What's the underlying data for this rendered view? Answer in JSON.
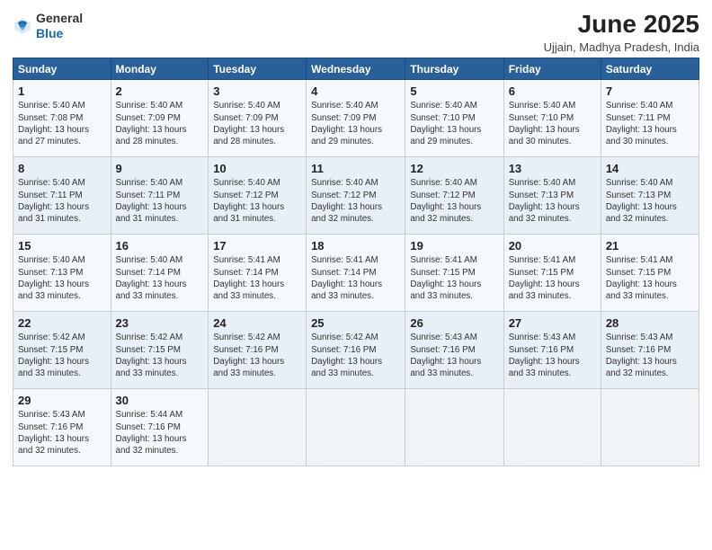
{
  "app": {
    "logo_line1": "General",
    "logo_line2": "Blue"
  },
  "header": {
    "title": "June 2025",
    "subtitle": "Ujjain, Madhya Pradesh, India"
  },
  "weekdays": [
    "Sunday",
    "Monday",
    "Tuesday",
    "Wednesday",
    "Thursday",
    "Friday",
    "Saturday"
  ],
  "weeks": [
    [
      {
        "day": "1",
        "info": "Sunrise: 5:40 AM\nSunset: 7:08 PM\nDaylight: 13 hours\nand 27 minutes."
      },
      {
        "day": "2",
        "info": "Sunrise: 5:40 AM\nSunset: 7:09 PM\nDaylight: 13 hours\nand 28 minutes."
      },
      {
        "day": "3",
        "info": "Sunrise: 5:40 AM\nSunset: 7:09 PM\nDaylight: 13 hours\nand 28 minutes."
      },
      {
        "day": "4",
        "info": "Sunrise: 5:40 AM\nSunset: 7:09 PM\nDaylight: 13 hours\nand 29 minutes."
      },
      {
        "day": "5",
        "info": "Sunrise: 5:40 AM\nSunset: 7:10 PM\nDaylight: 13 hours\nand 29 minutes."
      },
      {
        "day": "6",
        "info": "Sunrise: 5:40 AM\nSunset: 7:10 PM\nDaylight: 13 hours\nand 30 minutes."
      },
      {
        "day": "7",
        "info": "Sunrise: 5:40 AM\nSunset: 7:11 PM\nDaylight: 13 hours\nand 30 minutes."
      }
    ],
    [
      {
        "day": "8",
        "info": "Sunrise: 5:40 AM\nSunset: 7:11 PM\nDaylight: 13 hours\nand 31 minutes."
      },
      {
        "day": "9",
        "info": "Sunrise: 5:40 AM\nSunset: 7:11 PM\nDaylight: 13 hours\nand 31 minutes."
      },
      {
        "day": "10",
        "info": "Sunrise: 5:40 AM\nSunset: 7:12 PM\nDaylight: 13 hours\nand 31 minutes."
      },
      {
        "day": "11",
        "info": "Sunrise: 5:40 AM\nSunset: 7:12 PM\nDaylight: 13 hours\nand 32 minutes."
      },
      {
        "day": "12",
        "info": "Sunrise: 5:40 AM\nSunset: 7:12 PM\nDaylight: 13 hours\nand 32 minutes."
      },
      {
        "day": "13",
        "info": "Sunrise: 5:40 AM\nSunset: 7:13 PM\nDaylight: 13 hours\nand 32 minutes."
      },
      {
        "day": "14",
        "info": "Sunrise: 5:40 AM\nSunset: 7:13 PM\nDaylight: 13 hours\nand 32 minutes."
      }
    ],
    [
      {
        "day": "15",
        "info": "Sunrise: 5:40 AM\nSunset: 7:13 PM\nDaylight: 13 hours\nand 33 minutes."
      },
      {
        "day": "16",
        "info": "Sunrise: 5:40 AM\nSunset: 7:14 PM\nDaylight: 13 hours\nand 33 minutes."
      },
      {
        "day": "17",
        "info": "Sunrise: 5:41 AM\nSunset: 7:14 PM\nDaylight: 13 hours\nand 33 minutes."
      },
      {
        "day": "18",
        "info": "Sunrise: 5:41 AM\nSunset: 7:14 PM\nDaylight: 13 hours\nand 33 minutes."
      },
      {
        "day": "19",
        "info": "Sunrise: 5:41 AM\nSunset: 7:15 PM\nDaylight: 13 hours\nand 33 minutes."
      },
      {
        "day": "20",
        "info": "Sunrise: 5:41 AM\nSunset: 7:15 PM\nDaylight: 13 hours\nand 33 minutes."
      },
      {
        "day": "21",
        "info": "Sunrise: 5:41 AM\nSunset: 7:15 PM\nDaylight: 13 hours\nand 33 minutes."
      }
    ],
    [
      {
        "day": "22",
        "info": "Sunrise: 5:42 AM\nSunset: 7:15 PM\nDaylight: 13 hours\nand 33 minutes."
      },
      {
        "day": "23",
        "info": "Sunrise: 5:42 AM\nSunset: 7:15 PM\nDaylight: 13 hours\nand 33 minutes."
      },
      {
        "day": "24",
        "info": "Sunrise: 5:42 AM\nSunset: 7:16 PM\nDaylight: 13 hours\nand 33 minutes."
      },
      {
        "day": "25",
        "info": "Sunrise: 5:42 AM\nSunset: 7:16 PM\nDaylight: 13 hours\nand 33 minutes."
      },
      {
        "day": "26",
        "info": "Sunrise: 5:43 AM\nSunset: 7:16 PM\nDaylight: 13 hours\nand 33 minutes."
      },
      {
        "day": "27",
        "info": "Sunrise: 5:43 AM\nSunset: 7:16 PM\nDaylight: 13 hours\nand 33 minutes."
      },
      {
        "day": "28",
        "info": "Sunrise: 5:43 AM\nSunset: 7:16 PM\nDaylight: 13 hours\nand 32 minutes."
      }
    ],
    [
      {
        "day": "29",
        "info": "Sunrise: 5:43 AM\nSunset: 7:16 PM\nDaylight: 13 hours\nand 32 minutes."
      },
      {
        "day": "30",
        "info": "Sunrise: 5:44 AM\nSunset: 7:16 PM\nDaylight: 13 hours\nand 32 minutes."
      },
      {
        "day": "",
        "info": ""
      },
      {
        "day": "",
        "info": ""
      },
      {
        "day": "",
        "info": ""
      },
      {
        "day": "",
        "info": ""
      },
      {
        "day": "",
        "info": ""
      }
    ]
  ]
}
